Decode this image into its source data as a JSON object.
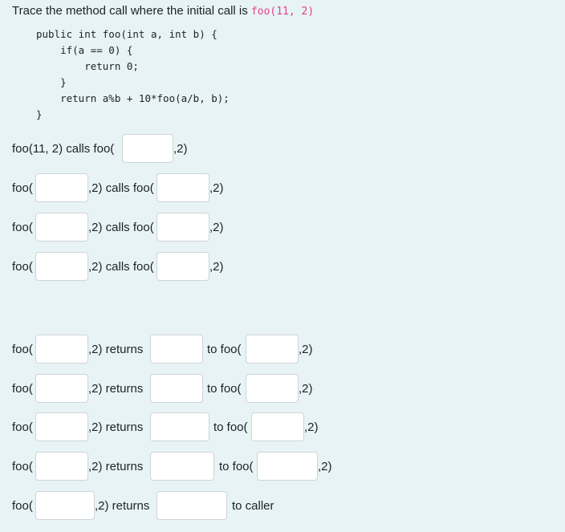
{
  "question": {
    "prefix": "Trace the method call where the initial call is ",
    "call": "foo(11, 2)"
  },
  "code": "public int foo(int a, int b) {\n    if(a == 0) {\n        return 0;\n    }\n    return a%b + 10*foo(a/b, b);\n}",
  "labels": {
    "first_call": "foo(11, 2) calls foo(",
    "foo_open": "foo(",
    "comma2_calls_foo": ",2) calls foo(",
    "comma2_close": ",2)",
    "comma2_returns": ",2) returns",
    "to_foo": "to foo(",
    "to_caller": "to caller"
  },
  "answers": {
    "call1_arg": "",
    "call2_arg": "",
    "call2_next": "",
    "call3_arg": "",
    "call3_next": "",
    "call4_arg": "",
    "call4_next": "",
    "ret1_arg": "",
    "ret1_val": "",
    "ret1_to": "",
    "ret2_arg": "",
    "ret2_val": "",
    "ret2_to": "",
    "ret3_arg": "",
    "ret3_val": "",
    "ret3_to": "",
    "ret4_arg": "",
    "ret4_val": "",
    "ret4_to": "",
    "ret5_arg": "",
    "ret5_val": ""
  }
}
